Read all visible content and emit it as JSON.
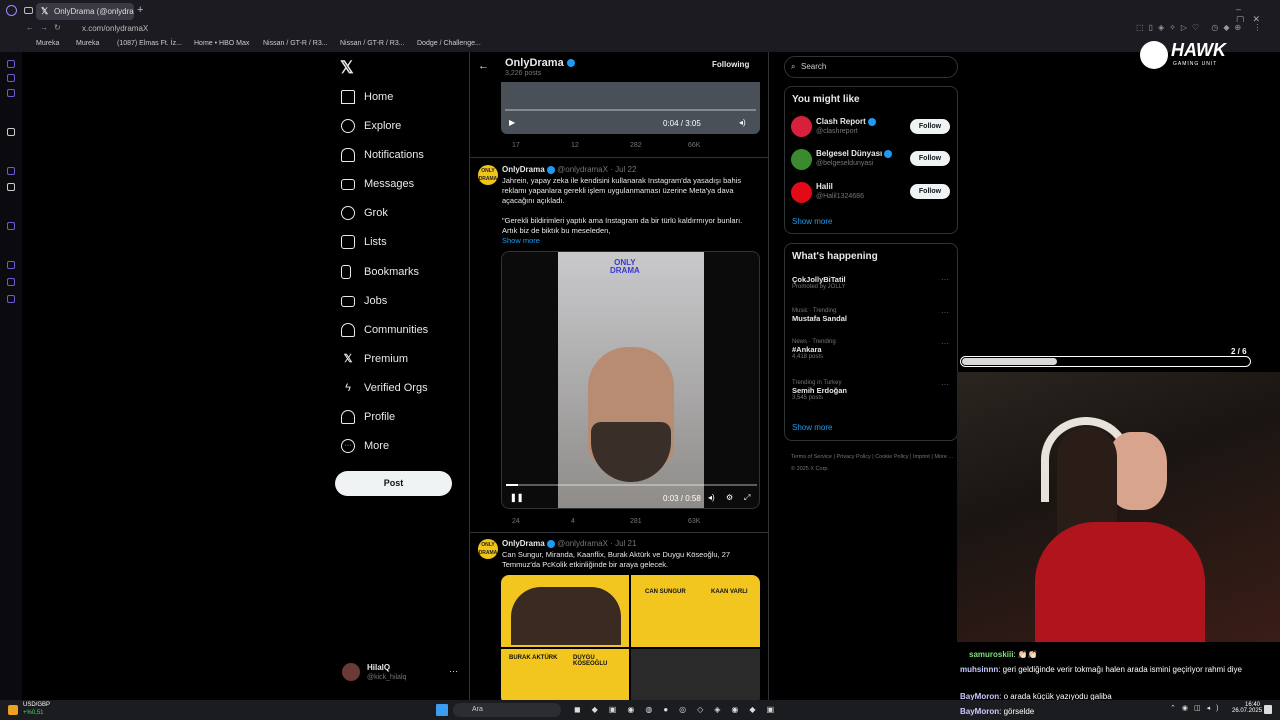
{
  "browser": {
    "tab_title": "OnlyDrama (@onlydramaX",
    "url": "x.com/onlydramaX",
    "bookmarks": [
      "Mureka",
      "Mureka",
      "(1087) Elmas Ft. İz...",
      "Home • HBO Max",
      "Nissan / GT-R / R3...",
      "Nissan / GT-R / R3...",
      "Dodge / Challenge..."
    ]
  },
  "nav": {
    "items": [
      {
        "label": "Home",
        "icon": "home-icon"
      },
      {
        "label": "Explore",
        "icon": "search-icon"
      },
      {
        "label": "Notifications",
        "icon": "bell-icon"
      },
      {
        "label": "Messages",
        "icon": "mail-icon"
      },
      {
        "label": "Grok",
        "icon": "grok-icon"
      },
      {
        "label": "Lists",
        "icon": "list-icon"
      },
      {
        "label": "Bookmarks",
        "icon": "bookmark-icon"
      },
      {
        "label": "Jobs",
        "icon": "briefcase-icon"
      },
      {
        "label": "Communities",
        "icon": "people-icon"
      },
      {
        "label": "Premium",
        "icon": "x-icon"
      },
      {
        "label": "Verified Orgs",
        "icon": "bolt-icon"
      },
      {
        "label": "Profile",
        "icon": "person-icon"
      },
      {
        "label": "More",
        "icon": "more-icon"
      }
    ],
    "post_label": "Post",
    "user_name": "HilalQ",
    "user_handle": "@kick_hilalq"
  },
  "header": {
    "name": "OnlyDrama",
    "posts": "3,226 posts",
    "following": "Following"
  },
  "video1": {
    "time": "0:04 / 3:05"
  },
  "tweet0_actions": {
    "replies": "17",
    "reposts": "12",
    "likes": "282",
    "views": "66K"
  },
  "tweet1": {
    "name": "OnlyDrama",
    "handle": "@onlydramaX",
    "date": "· Jul 22",
    "text": "Jahrein, yapay zeka ile kendisini kullanarak Instagram'da yasadışı bahis reklamı yapanlara gerekli işlem uygulanmaması üzerine Meta'ya dava açacağını açıkladı.",
    "quote": "\"Gerekli bildirimleri yaptık ama Instagram da bir türlü kaldırmıyor bunları. Artık biz de biktık bu meseleden,",
    "show_more": "Show more",
    "logo_line1": "ONLY",
    "logo_line2": "DRAMA",
    "video_time": "0:03 / 0:58",
    "replies": "24",
    "reposts": "4",
    "likes": "281",
    "views": "63K"
  },
  "tweet2": {
    "name": "OnlyDrama",
    "handle": "@onlydramaX",
    "date": "· Jul 21",
    "text": "Can Sungur, Miranda, Kaanflix, Burak Aktürk ve Duygu Köseoğlu, 27 Temmuz'da PcKolik etkinliğinde bir araya gelecek.",
    "tiles": [
      "CAN SUNGUR",
      "KAAN VARLI",
      "BURAK AKTÜRK",
      "DUYGU KÖSEOĞLU"
    ]
  },
  "search": {
    "placeholder": "Search"
  },
  "suggest": {
    "title": "You might like",
    "show_more": "Show more",
    "follow_label": "Follow",
    "users": [
      {
        "name": "Clash Report",
        "handle": "@clashreport",
        "color": "#d9203a"
      },
      {
        "name": "Belgesel Dünyası",
        "handle": "@belgeseldunyasi",
        "color": "#3c8a2f"
      },
      {
        "name": "Halil",
        "handle": "@Halil1324686",
        "color": "#e30a17"
      }
    ]
  },
  "trends": {
    "title": "What's happening",
    "show_more": "Show more",
    "items": [
      {
        "meta": "",
        "name": "ÇokJollyBiTatil",
        "sub": "Promoted by JOLLY"
      },
      {
        "meta": "Music · Trending",
        "name": "Mustafa Sandal",
        "sub": ""
      },
      {
        "meta": "News · Trending",
        "name": "#Ankara",
        "sub": "4,418 posts"
      },
      {
        "meta": "Trending in Turkey",
        "name": "Semih Erdoğan",
        "sub": "3,545 posts"
      }
    ]
  },
  "footer": {
    "links": [
      "Terms of Service",
      "Privacy Policy",
      "Cookie Policy",
      "Imprint",
      "More ...",
      "© 2025 X Corp."
    ]
  },
  "overlay": {
    "brand": "HAWK",
    "brand_sub": "GAMING UNIT",
    "progress_label": "2 / 6",
    "progress": 0.33
  },
  "chat": [
    {
      "user": "samuroskiii",
      "msg": ": 👏🏻👏🏻",
      "color": "#7ee07e"
    },
    {
      "user": "muhsinnn",
      "msg": ": geri geldiğinde verir tokmağı halen arada ismini geçiriyor rahmi diye",
      "color": "#c9c9ff"
    },
    {
      "user": "BayMoron",
      "msg": ": o arada küçük yazıyodu galiba",
      "color": "#c9c9ff"
    },
    {
      "user": "BayMoron",
      "msg": ": görselde",
      "color": "#c9c9ff"
    }
  ],
  "taskbar": {
    "ticker": "USD/GBP",
    "ticker_change": "+%0,51",
    "search": "Ara",
    "time": "16:40",
    "date": "26.07.2025"
  }
}
